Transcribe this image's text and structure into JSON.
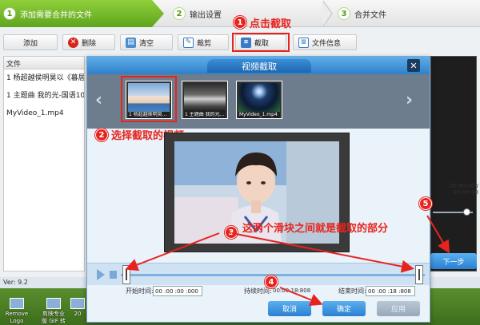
{
  "steps": [
    {
      "num": "1",
      "label": "添加需要合并的文件"
    },
    {
      "num": "2",
      "label": "输出设置"
    },
    {
      "num": "3",
      "label": "合并文件"
    }
  ],
  "toolbar": {
    "add": "添加",
    "delete": "删除",
    "clear": "清空",
    "cut": "裁剪",
    "crop": "截取",
    "info": "文件信息"
  },
  "filelist": {
    "header": "文件",
    "rows": [
      "1 杨超越侯明昊以《暮居",
      "1 主题曲 我的光-国语10",
      "MyVideo_1.mp4"
    ]
  },
  "right_panel": {
    "time": "00:00:00 / 00:00:00",
    "next": "下一步"
  },
  "status": {
    "version": "Ver: 9.2"
  },
  "desktop_icons": [
    "Remove Logo Now",
    "剪映专业版 GIF 转换",
    "20"
  ],
  "dialog": {
    "title": "视频截取",
    "close": "✕",
    "thumbs": [
      "1 杨超越侯明昊...",
      "1 主题曲 我的光...",
      "MyVideo_1.mp4"
    ],
    "start_label": "开始时间:",
    "start_value": "00 :00 :00 :000",
    "duration_label": "持续时间:",
    "duration_value": "00:00:18:808",
    "end_label": "结束时间:",
    "end_value": "00 :00 :18 :808",
    "cancel": "取消",
    "ok": "确定",
    "apply": "应用"
  },
  "annotations": {
    "a1_num": "1",
    "a1_text": "点击截取",
    "a2_num": "2",
    "a2_text": "选择截取的视频",
    "a3_num": "3",
    "a3_text": "这两个滑块之间就是截取的部分",
    "a4_num": "4",
    "a5_num": "5"
  },
  "colors": {
    "accent_red": "#e8231d",
    "accent_blue": "#2f80c9",
    "step_green": "#5ea51e"
  }
}
